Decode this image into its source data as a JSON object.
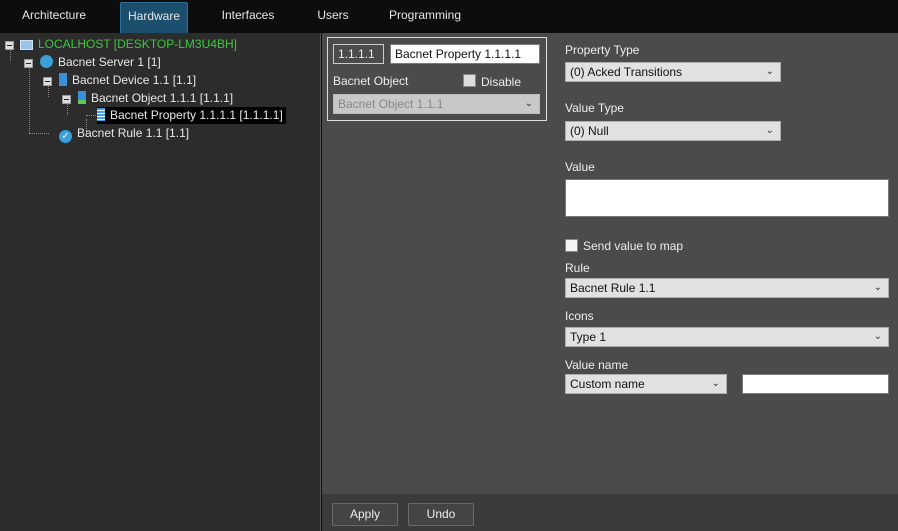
{
  "tabs": [
    {
      "label": "Architecture"
    },
    {
      "label": "Hardware",
      "active": true
    },
    {
      "label": "Interfaces"
    },
    {
      "label": "Users"
    },
    {
      "label": "Programming"
    }
  ],
  "tree": {
    "root": "LOCALHOST [DESKTOP-LM3U4BH]",
    "server": "Bacnet Server 1 [1]",
    "device": "Bacnet Device 1.1 [1.1]",
    "object": "Bacnet Object 1.1.1 [1.1.1]",
    "property": "Bacnet Property 1.1.1.1 [1.1.1.1]",
    "rule": "Bacnet Rule 1.1 [1.1]"
  },
  "header": {
    "id": "1.1.1.1",
    "name": "Bacnet Property 1.1.1.1",
    "object_label": "Bacnet Object",
    "disable_label": "Disable",
    "object_value": "Bacnet Object 1.1.1"
  },
  "form": {
    "property_type_label": "Property Type",
    "property_type": "(0) Acked Transitions",
    "value_type_label": "Value Type",
    "value_type": "(0) Null",
    "value_label": "Value",
    "value": "",
    "send_label": "Send value to map",
    "rule_label": "Rule",
    "rule": "Bacnet Rule 1.1",
    "icons_label": "Icons",
    "icons": "Type 1",
    "value_name_label": "Value name",
    "value_name": "Custom name",
    "custom_value": ""
  },
  "buttons": {
    "apply": "Apply",
    "undo": "Undo"
  },
  "colors": {
    "accent": "#1c4e6e",
    "root_text": "#3ec63e"
  }
}
